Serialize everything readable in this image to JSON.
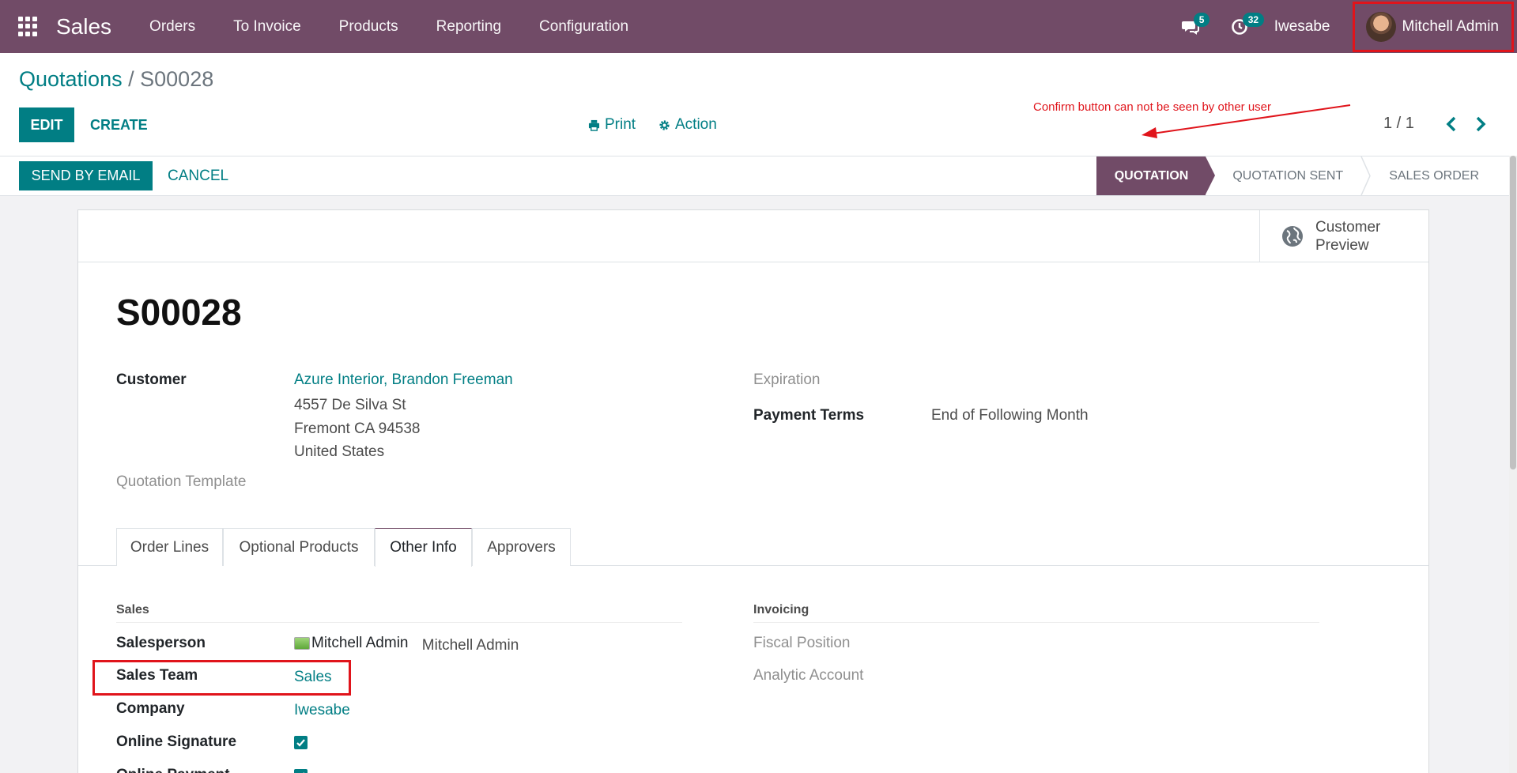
{
  "navbar": {
    "app_name": "Sales",
    "menu": [
      "Orders",
      "To Invoice",
      "Products",
      "Reporting",
      "Configuration"
    ],
    "messages_count": "5",
    "activities_count": "32",
    "company": "Iwesabe",
    "user": "Mitchell Admin"
  },
  "control_panel": {
    "breadcrumb_parent": "Quotations",
    "breadcrumb_sep": "/",
    "breadcrumb_current": "S00028",
    "edit_label": "EDIT",
    "create_label": "CREATE",
    "print_label": "Print",
    "action_label": "Action",
    "pager": "1 / 1",
    "annotation": "Confirm button can not be seen by other user"
  },
  "statusbar": {
    "send_email_label": "SEND BY EMAIL",
    "cancel_label": "CANCEL",
    "stages": [
      "QUOTATION",
      "QUOTATION SENT",
      "SALES ORDER"
    ],
    "active_stage": "QUOTATION"
  },
  "form": {
    "customer_preview_label": "Customer Preview",
    "name": "S00028",
    "customer_label": "Customer",
    "customer_name": "Azure Interior, Brandon Freeman",
    "address_line1": "4557 De Silva St",
    "address_line2": "Fremont CA 94538",
    "address_line3": "United States",
    "quotation_template_label": "Quotation Template",
    "expiration_label": "Expiration",
    "payment_terms_label": "Payment Terms",
    "payment_terms_value": "End of Following Month",
    "tabs": [
      "Order Lines",
      "Optional Products",
      "Other Info",
      "Approvers"
    ],
    "active_tab": "Other Info",
    "sales_section": "Sales",
    "invoicing_section": "Invoicing",
    "salesperson_label": "Salesperson",
    "salesperson_img_alt": "Mitchell Admin",
    "salesperson_value": "Mitchell Admin",
    "sales_team_label": "Sales Team",
    "sales_team_value": "Sales",
    "company_label": "Company",
    "company_value": "Iwesabe",
    "online_signature_label": "Online Signature",
    "online_signature_checked": true,
    "online_payment_label": "Online Payment",
    "online_payment_checked": true,
    "fiscal_position_label": "Fiscal Position",
    "analytic_account_label": "Analytic Account"
  },
  "colors": {
    "brand": "#714b67",
    "accent": "#017e84",
    "annotation_red": "#e0141b"
  }
}
